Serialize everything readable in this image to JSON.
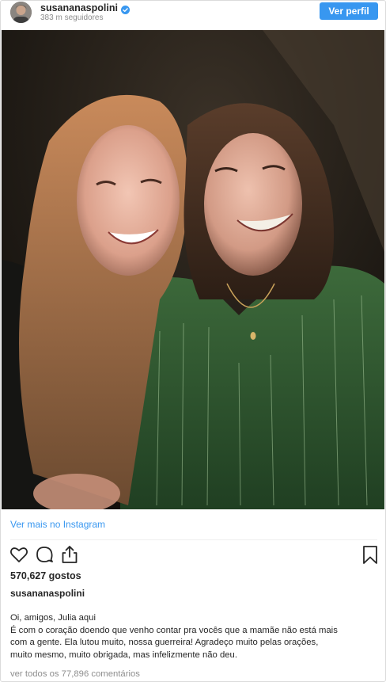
{
  "header": {
    "username": "susananaspolini",
    "followers": "383 m seguidores",
    "profile_button": "Ver perfil"
  },
  "post": {
    "image_alt": "",
    "view_more_link": "Ver mais no Instagram",
    "likes": "570,627 gostos",
    "caption_username": "susananaspolini",
    "caption_lines": [
      "Oi, amigos, Julia aqui",
      "É com o coração doendo que venho contar pra vocês que a mamãe não está mais",
      "com a gente. Ela lutou muito, nossa guerreira! Agradeço muito pelas orações,",
      "muito mesmo, muito obrigada, mas infelizmente não deu."
    ],
    "view_comments": "ver todos os 77,896 comentários"
  },
  "icons": {
    "verified": "verified-badge-icon",
    "like": "heart-outline-icon",
    "comment": "comment-bubble-icon",
    "share": "share-upload-icon",
    "save": "bookmark-outline-icon"
  },
  "colors": {
    "accent": "#3897f0",
    "verified": "#3897f0",
    "text": "#262626",
    "muted": "#8e8e8e"
  }
}
